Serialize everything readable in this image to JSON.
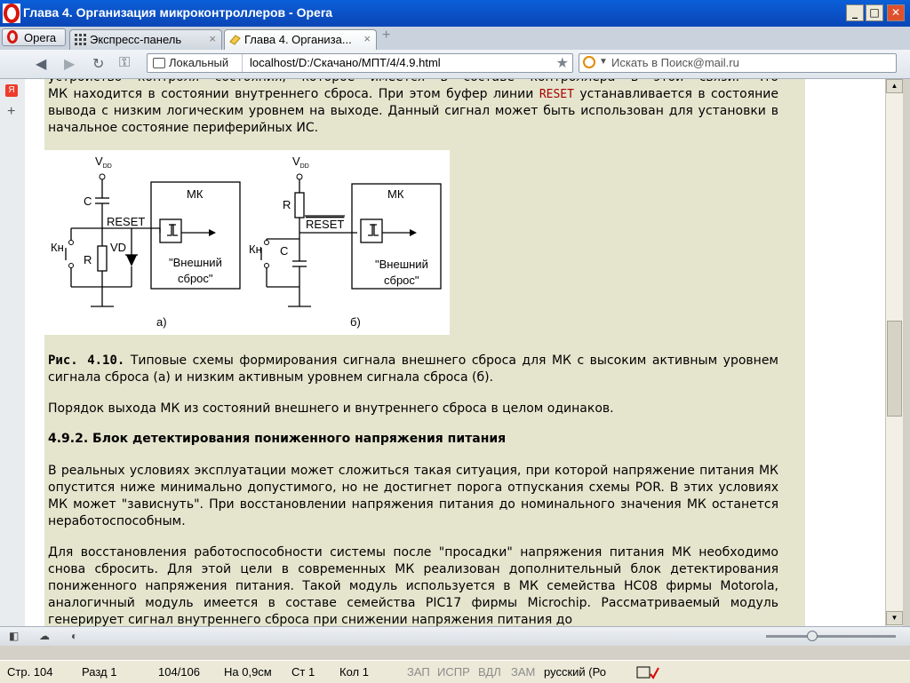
{
  "window": {
    "title": "Глава 4. Организация микроконтроллеров - Opera",
    "minimize": "_",
    "maximize": "□",
    "close": "✕"
  },
  "tabs": {
    "menu_label": "Opera",
    "items": [
      {
        "label": "Экспресс-панель",
        "close": "×"
      },
      {
        "label": "Глава 4. Организа...",
        "close": "×"
      }
    ],
    "new_tab": "+"
  },
  "toolbar": {
    "back": "◀",
    "forward": "▶",
    "reload": "↻",
    "key": "⚿",
    "site_label": "Локальный",
    "url": "localhost/D:/Скачано/МПТ/4/4.9.html",
    "bookmark": "★",
    "search_placeholder": "Искать в Поиск@mail.ru",
    "search_dropdown": "▼"
  },
  "sidebar": {
    "yandex": "Я",
    "add": "+"
  },
  "content": {
    "para_top_line0": "устройство контроля состояния, которое имеется в составе контроллера в этой связи. Что",
    "para_top_a": "МК находится в состоянии внутреннего сброса. При этом буфер линии ",
    "para_top_reset": "RESET",
    "para_top_b": " устанавливается в состояние вывода с низким логическим уровнем на выходе. Данный сигнал может быть использован для установки в начальное состояние периферийных ИС.",
    "figure": {
      "vdd": "V",
      "vdd_sub": "DD",
      "mk": "МК",
      "c": "C",
      "r": "R",
      "vd": "VD",
      "kn": "Кн",
      "reset": "RESET",
      "ext1": "\"Внешний",
      "ext2": "сброс\"",
      "label_a": "а)",
      "label_b": "б)"
    },
    "caption_num": "Рис. 4.10.",
    "caption_text": " Типовые схемы формирования сигнала внешнего сброса для МК с высоким активным уровнем сигнала сброса (а) и низким активным уровнем сигнала сброса (б).",
    "para_exit": "Порядок выхода МК из состояний внешнего и внутреннего сброса в целом одинаков.",
    "heading": "4.9.2. Блок детектирования пониженного напряжения питания",
    "para_real": "В реальных условиях эксплуатации может сложиться такая ситуация, при которой напряжение питания МК опустится ниже минимально допустимого, но не достигнет порога отпускания схемы POR. В этих условиях МК может \"зависнуть\". При восстановлении напряжения питания до номинального значения МК останется неработоспособным.",
    "para_restore": "Для восстановления работоспособности системы после \"просадки\" напряжения питания МК необходимо снова сбросить. Для этой цели в современных МК реализован дополнительный блок детектирования пониженного напряжения питания. Такой модуль используется в МК семейства HC08 фирмы Motorola, аналогичный модуль имеется в составе семейства PIC17 фирмы Microchip. Рассматриваемый модуль генерирует сигнал внутреннего сброса при снижении напряжения питания до"
  },
  "scrollbar": {
    "up": "▲",
    "down": "▼"
  },
  "statusbar": {
    "panel_icon": "◧",
    "cloud_icon": "☁",
    "speed_icon": "◐"
  },
  "word_status": {
    "page": "Стр. 104",
    "section": "Разд 1",
    "pages": "104/106",
    "at": "На 0,9см",
    "line": "Ст 1",
    "col": "Кол 1",
    "rec": "ЗАП",
    "trk": "ИСПР",
    "ext": "ВДЛ",
    "ovr": "ЗАМ",
    "lang": "русский (Ро"
  },
  "colors": {
    "title_bar": "#0b4fc4",
    "page_bg": "#e5e5ce",
    "reset_text": "#a80000",
    "opera_red": "#d8150d"
  }
}
